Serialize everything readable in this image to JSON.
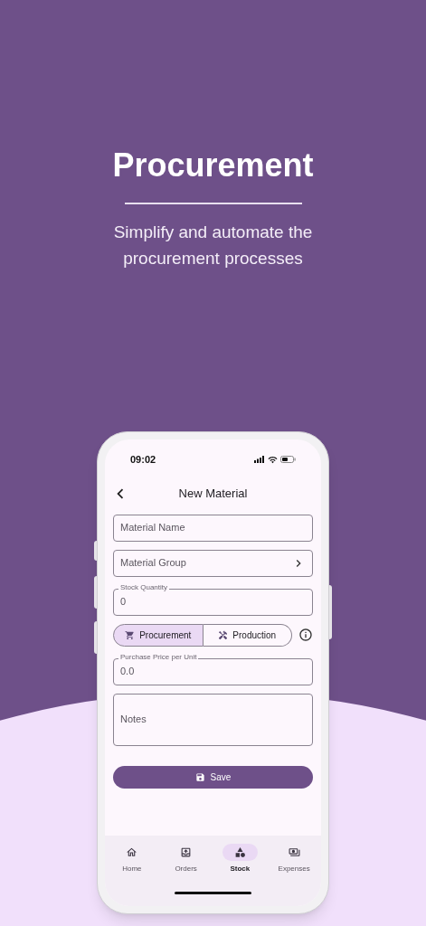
{
  "hero": {
    "title": "Procurement",
    "subtitle": "Simplify and automate the procurement processes"
  },
  "phone": {
    "status_bar": {
      "time": "09:02"
    },
    "header": {
      "title": "New Material"
    },
    "form": [
      {
        "kind": "text",
        "placeholder": "Material Name"
      },
      {
        "kind": "select",
        "placeholder": "Material Group"
      },
      {
        "kind": "filled",
        "label": "Stock Quantity",
        "value": "0"
      },
      {
        "kind": "segmented",
        "options": [
          {
            "label": "Procurement",
            "selected": true
          },
          {
            "label": "Production",
            "selected": false
          }
        ]
      },
      {
        "kind": "filled",
        "label": "Purchase Price per Unit",
        "value": "0.0"
      },
      {
        "kind": "textarea",
        "placeholder": "Notes"
      }
    ],
    "save_button": "Save",
    "nav": [
      {
        "label": "Home",
        "selected": false
      },
      {
        "label": "Orders",
        "selected": false
      },
      {
        "label": "Stock",
        "selected": true
      },
      {
        "label": "Expenses",
        "selected": false
      }
    ]
  }
}
